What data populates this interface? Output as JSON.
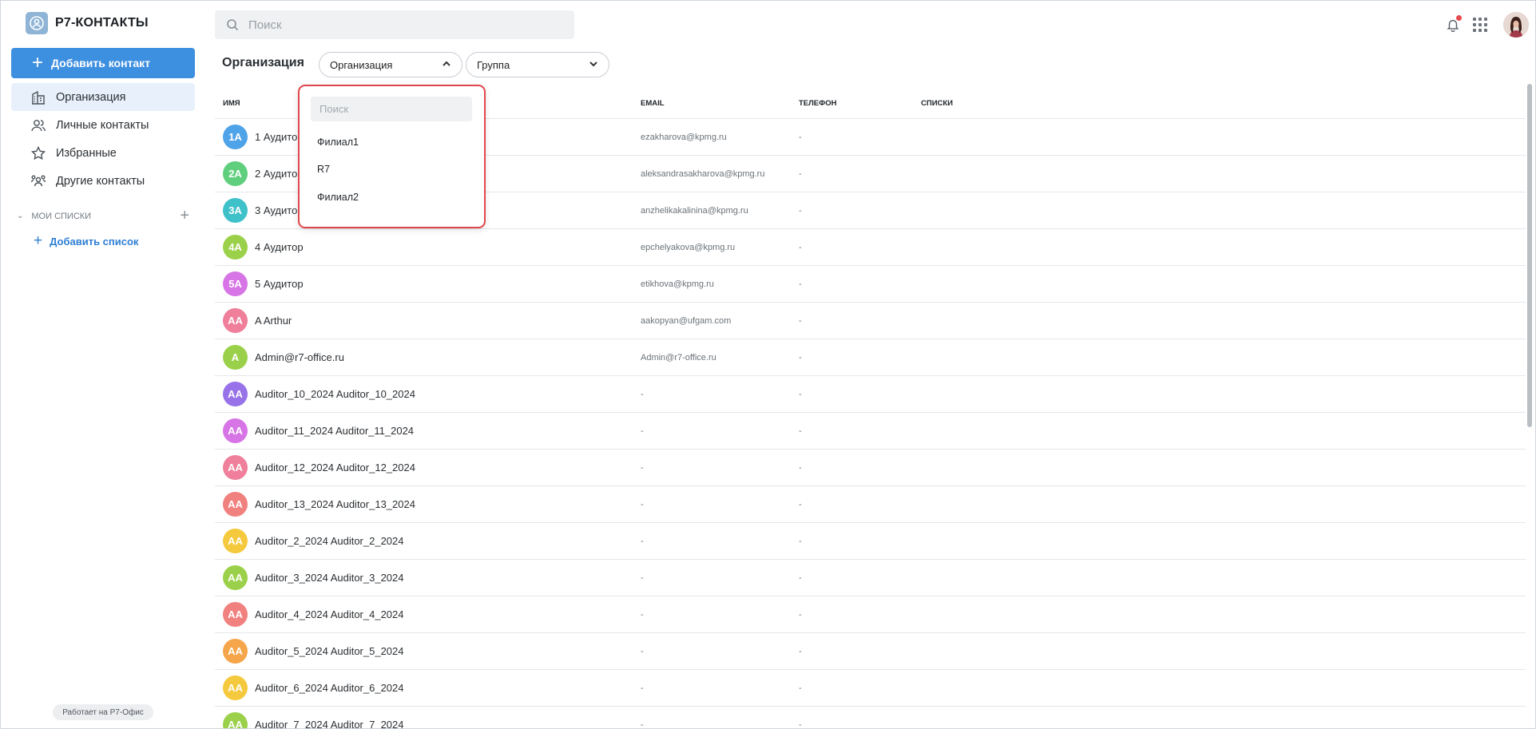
{
  "app": {
    "title": "Р7-КОНТАКТЫ",
    "powered_by": "Работает на Р7-Офис"
  },
  "sidebar": {
    "add_contact_label": "Добавить контакт",
    "items": [
      {
        "label": "Организация",
        "icon": "building-icon",
        "active": true
      },
      {
        "label": "Личные контакты",
        "icon": "people-icon",
        "active": false
      },
      {
        "label": "Избранные",
        "icon": "star-icon",
        "active": false
      },
      {
        "label": "Другие контакты",
        "icon": "group-icon",
        "active": false
      }
    ],
    "lists_section_label": "мои списки",
    "add_list_label": "Добавить список"
  },
  "search": {
    "placeholder": "Поиск"
  },
  "header": {
    "page_title": "Организация",
    "filter_org_label": "Организация",
    "filter_group_label": "Группа"
  },
  "dropdown": {
    "search_placeholder": "Поиск",
    "options": [
      "Филиал1",
      "R7",
      "Филиал2"
    ]
  },
  "table": {
    "columns": [
      "ИМЯ",
      "EMAIL",
      "ТЕЛЕФОН",
      "СПИСКИ"
    ],
    "rows": [
      {
        "initials": "1А",
        "color": "#4fa3e8",
        "name": "1 Аудитор",
        "email": "ezakharova@kpmg.ru",
        "phone": "-"
      },
      {
        "initials": "2А",
        "color": "#5fcf7d",
        "name": "2 Аудитор",
        "email": "aleksandrasakharova@kpmg.ru",
        "phone": "-"
      },
      {
        "initials": "3А",
        "color": "#3fc1c9",
        "name": "3 Аудитор",
        "email": "anzhelikakalinina@kpmg.ru",
        "phone": "-"
      },
      {
        "initials": "4А",
        "color": "#9bd14a",
        "name": "4 Аудитор",
        "email": "epchelyakova@kpmg.ru",
        "phone": "-"
      },
      {
        "initials": "5А",
        "color": "#d775e6",
        "name": "5 Аудитор",
        "email": "etikhova@kpmg.ru",
        "phone": "-"
      },
      {
        "initials": "AA",
        "color": "#ef7f9a",
        "name": "A Arthur",
        "email": "aakopyan@ufgam.com",
        "phone": "-"
      },
      {
        "initials": "A",
        "color": "#9bd14a",
        "name": "Admin@r7-office.ru",
        "email": "Admin@r7-office.ru",
        "phone": "-"
      },
      {
        "initials": "AA",
        "color": "#9772e8",
        "name": "Auditor_10_2024 Auditor_10_2024",
        "email": "-",
        "phone": "-"
      },
      {
        "initials": "AA",
        "color": "#d775e6",
        "name": "Auditor_11_2024 Auditor_11_2024",
        "email": "-",
        "phone": "-"
      },
      {
        "initials": "AA",
        "color": "#ef7f9a",
        "name": "Auditor_12_2024 Auditor_12_2024",
        "email": "-",
        "phone": "-"
      },
      {
        "initials": "AA",
        "color": "#f0817f",
        "name": "Auditor_13_2024 Auditor_13_2024",
        "email": "-",
        "phone": "-"
      },
      {
        "initials": "AA",
        "color": "#f5c93d",
        "name": "Auditor_2_2024 Auditor_2_2024",
        "email": "-",
        "phone": "-"
      },
      {
        "initials": "AA",
        "color": "#9bd14a",
        "name": "Auditor_3_2024 Auditor_3_2024",
        "email": "-",
        "phone": "-"
      },
      {
        "initials": "AA",
        "color": "#f0817f",
        "name": "Auditor_4_2024 Auditor_4_2024",
        "email": "-",
        "phone": "-"
      },
      {
        "initials": "AA",
        "color": "#f5a54a",
        "name": "Auditor_5_2024 Auditor_5_2024",
        "email": "-",
        "phone": "-"
      },
      {
        "initials": "AA",
        "color": "#f5c93d",
        "name": "Auditor_6_2024 Auditor_6_2024",
        "email": "-",
        "phone": "-"
      },
      {
        "initials": "AA",
        "color": "#9bd14a",
        "name": "Auditor_7_2024 Auditor_7_2024",
        "email": "-",
        "phone": "-"
      }
    ]
  },
  "colors": {
    "accent": "#3d8fe0",
    "dropdown_highlight": "#e0474c",
    "notification_dot": "#e5484d"
  }
}
